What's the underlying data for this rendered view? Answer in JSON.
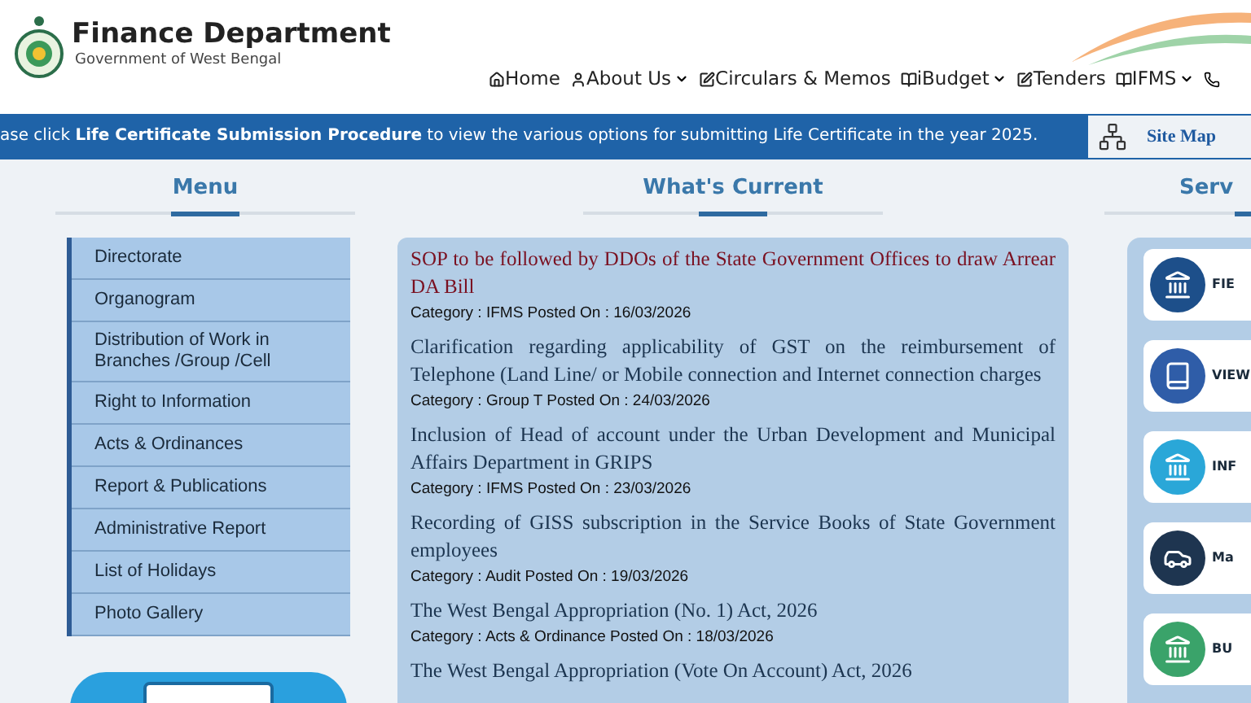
{
  "header": {
    "title": "Finance Department",
    "subtitle": "Government of West Bengal",
    "nav": [
      {
        "label": "Home",
        "dropdown": false
      },
      {
        "label": "About Us",
        "dropdown": true
      },
      {
        "label": "Circulars & Memos",
        "dropdown": false
      },
      {
        "label": "iBudget",
        "dropdown": true
      },
      {
        "label": "Tenders",
        "dropdown": false
      },
      {
        "label": "IFMS",
        "dropdown": true
      }
    ]
  },
  "banner": {
    "text": "ase click **Life Certificate Submission Procedure** to view the various options for submitting Life Certificate in the year 2025.",
    "site_map": "Site Map"
  },
  "menu": {
    "heading": "Menu",
    "items": [
      "Directorate",
      "Organogram",
      "Distribution of Work in Branches /Group /Cell",
      "Right to Information",
      "Acts & Ordinances",
      "Report & Publications",
      "Administrative Report",
      "List of Holidays",
      "Photo Gallery"
    ]
  },
  "news": {
    "heading": "What's Current",
    "items": [
      {
        "title": "SOP to be followed by DDOs of the State Government Offices to draw Arrear DA Bill",
        "meta": "Category : IFMS Posted On :  16/03/2026",
        "highlighted": true
      },
      {
        "title": "Clarification regarding applicability of GST on the reimbursement of Telephone (Land Line/ or Mobile connection and Internet connection charges",
        "meta": "Category : Group T Posted On : 24/03/2026",
        "highlighted": false
      },
      {
        "title": "Inclusion of Head of account under the Urban Development and Municipal Affairs Department in GRIPS",
        "meta": "Category : IFMS Posted On : 23/03/2026",
        "highlighted": false
      },
      {
        "title": "Recording of GISS subscription in the Service Books of State Government employees",
        "meta": "Category : Audit Posted On : 19/03/2026",
        "highlighted": false
      },
      {
        "title": "The West Bengal Appropriation (No. 1) Act, 2026",
        "meta": "Category : Acts & Ordinance Posted On : 18/03/2026",
        "highlighted": false
      },
      {
        "title": "The West Bengal Appropriation (Vote On Account) Act, 2026",
        "highlighted": false
      }
    ]
  },
  "services": {
    "heading": "Serv",
    "cards": [
      "FIE",
      "VIEW",
      "INF",
      "Ma",
      "BU"
    ]
  }
}
